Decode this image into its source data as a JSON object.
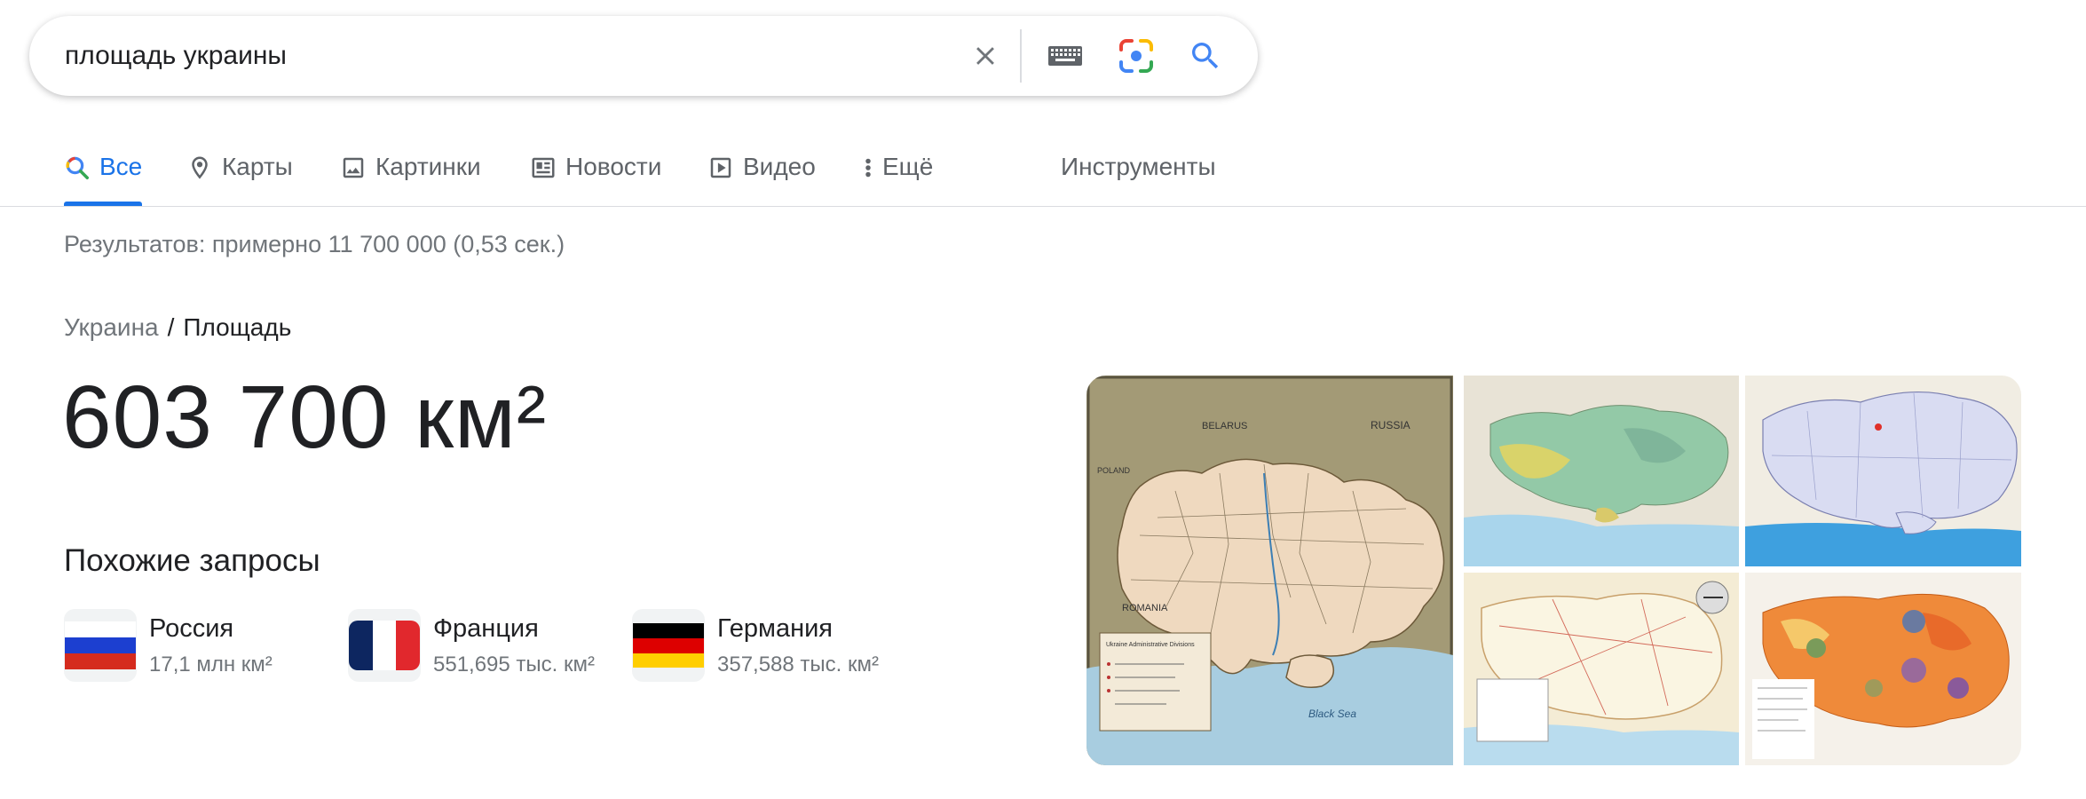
{
  "search": {
    "query": "площадь украины"
  },
  "tabs": [
    {
      "label": "Все",
      "active": true
    },
    {
      "label": "Карты"
    },
    {
      "label": "Картинки"
    },
    {
      "label": "Новости"
    },
    {
      "label": "Видео"
    },
    {
      "label": "Ещё"
    }
  ],
  "tools_label": "Инструменты",
  "result_stats": "Результатов: примерно 11 700 000 (0,53 сек.)",
  "breadcrumb": {
    "parent": "Украина",
    "separator": "/",
    "current": "Площадь"
  },
  "answer": "603 700 км²",
  "related": {
    "title": "Похожие запросы",
    "items": [
      {
        "name": "Россия",
        "value": "17,1 млн км²",
        "flag": "russia-flag"
      },
      {
        "name": "Франция",
        "value": "551,695 тыс. км²",
        "flag": "france-flag"
      },
      {
        "name": "Германия",
        "value": "357,588 тыс. км²",
        "flag": "germany-flag"
      }
    ]
  },
  "map_labels": {
    "belarus": "BELARUS",
    "russia": "RUSSIA",
    "poland": "POLAND",
    "romania": "ROMANIA",
    "black_sea": "Black Sea",
    "legend_title": "Ukraine Administrative Divisions"
  },
  "colors": {
    "accent": "#1a73e8",
    "text": "#202124",
    "secondary": "#70757a"
  }
}
